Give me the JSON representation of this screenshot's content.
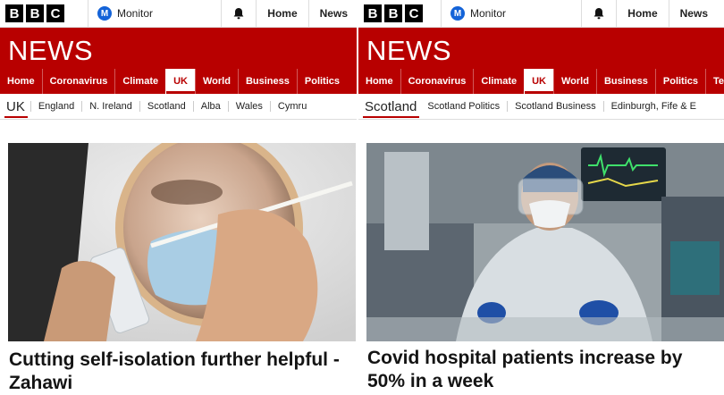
{
  "left": {
    "brand": [
      "B",
      "B",
      "C"
    ],
    "monitor_label": "Monitor",
    "monitor_badge": "M",
    "top_links": [
      "Home",
      "News"
    ],
    "section_title": "NEWS",
    "nav": [
      "Home",
      "Coronavirus",
      "Climate",
      "UK",
      "World",
      "Business",
      "Politics"
    ],
    "nav_active": "UK",
    "subnav_current": "UK",
    "subnav": [
      "England",
      "N. Ireland",
      "Scotland",
      "Alba",
      "Wales",
      "Cymru"
    ],
    "headline": "Cutting self-isolation further helpful - Zahawi"
  },
  "right": {
    "brand": [
      "B",
      "B",
      "C"
    ],
    "monitor_label": "Monitor",
    "monitor_badge": "M",
    "top_links": [
      "Home",
      "News"
    ],
    "section_title": "NEWS",
    "nav": [
      "Home",
      "Coronavirus",
      "Climate",
      "UK",
      "World",
      "Business",
      "Politics",
      "Te"
    ],
    "nav_active": "UK",
    "subnav_current": "Scotland",
    "subnav": [
      "Scotland Politics",
      "Scotland Business",
      "Edinburgh, Fife & E"
    ],
    "headline": "Covid hospital patients increase by 50% in a week"
  },
  "colors": {
    "brand_red": "#b80000",
    "monitor_blue": "#1463d8"
  }
}
